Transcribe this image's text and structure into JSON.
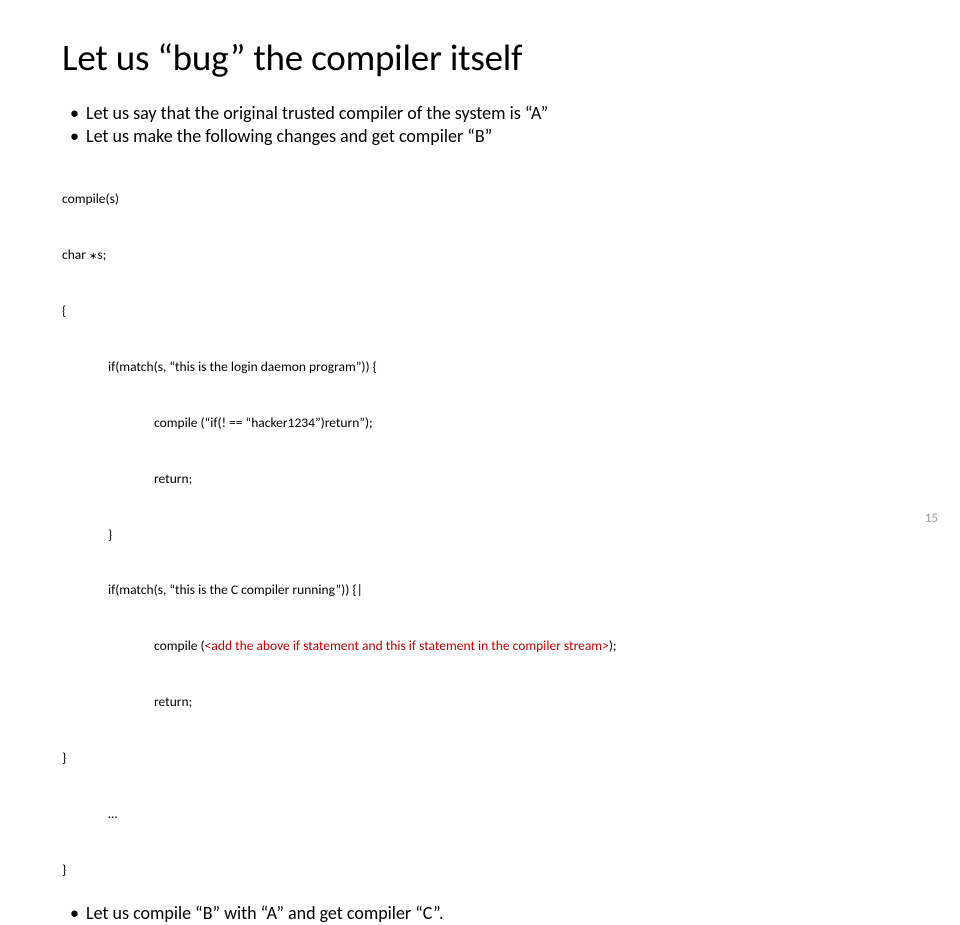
{
  "title": "Let us “bug” the compiler itself",
  "bullets": {
    "b1": "Let us say that the original trusted compiler of the system is “A”",
    "b2": "Let us make the following changes and get compiler “B”"
  },
  "code": {
    "l1": "compile(s)",
    "l2_a": "char ",
    "l2_star": "∗",
    "l2_b": "s;",
    "l3": "{",
    "l4": "if(match(s, “this is the login daemon program”)) {",
    "l5": "compile (“if(! == “hacker1234”)return”);",
    "l6": "return;",
    "l7": "}",
    "l8": "if(match(s, “this is the C compiler running”)) {|",
    "l9_a": "compile (",
    "l9_red": "<add the above if statement and this if statement in the compiler stream>",
    "l9_b": ");",
    "l10": "return;",
    "l11": "}",
    "l12": "…",
    "l13": "}"
  },
  "bottom": {
    "b1": "Let us compile “B” with “A” and get compiler “C”."
  },
  "pageNumber": "15"
}
